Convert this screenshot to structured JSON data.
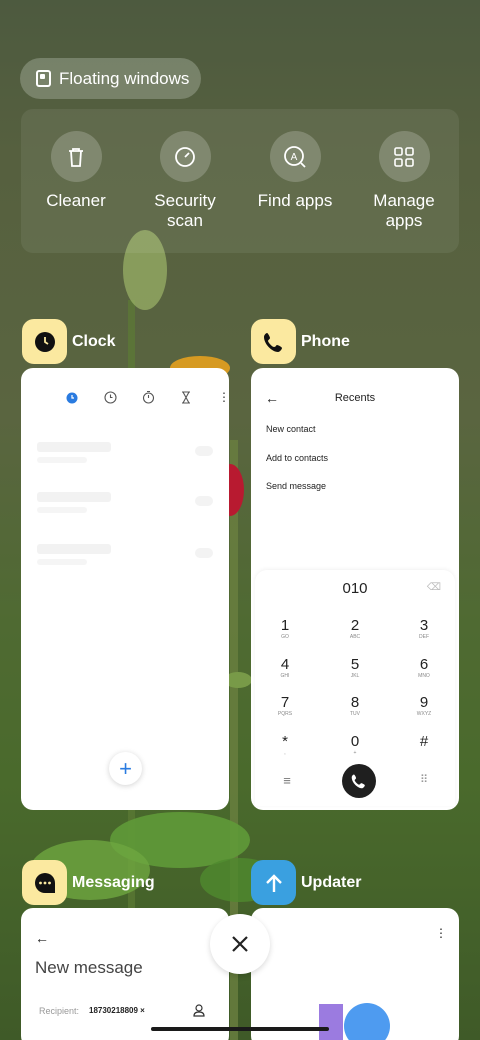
{
  "floating_windows": {
    "label": "Floating windows"
  },
  "tools": [
    {
      "label": "Cleaner",
      "icon": "trash-icon"
    },
    {
      "label": "Security\nscan",
      "icon": "security-scan-icon"
    },
    {
      "label": "Find apps",
      "icon": "find-apps-icon"
    },
    {
      "label": "Manage\napps",
      "icon": "grid-icon"
    }
  ],
  "apps": {
    "clock": {
      "name": "Clock",
      "icon_color": "#fbe9a0",
      "fab_label": "+"
    },
    "phone": {
      "name": "Phone",
      "icon_color": "#fbe9a0",
      "back": "←",
      "title": "Recents",
      "menu": [
        "New contact",
        "Add to contacts",
        "Send message"
      ],
      "dialed_number": "010",
      "delete_icon": "⌫",
      "keys": [
        {
          "digit": "1",
          "letters": "GO"
        },
        {
          "digit": "2",
          "letters": "ABC"
        },
        {
          "digit": "3",
          "letters": "DEF"
        },
        {
          "digit": "4",
          "letters": "GHI"
        },
        {
          "digit": "5",
          "letters": "JKL"
        },
        {
          "digit": "6",
          "letters": "MNO"
        },
        {
          "digit": "7",
          "letters": "PQRS"
        },
        {
          "digit": "8",
          "letters": "TUV"
        },
        {
          "digit": "9",
          "letters": "WXYZ"
        },
        {
          "digit": "*",
          "letters": ","
        },
        {
          "digit": "0",
          "letters": "+"
        },
        {
          "digit": "#",
          "letters": ""
        }
      ],
      "menu_glyph": "≡",
      "keypad_glyph": "⠿"
    },
    "messaging": {
      "name": "Messaging",
      "icon_color": "#fbe9a0",
      "back": "←",
      "title": "New message",
      "recipient_label": "Recipient:",
      "recipient_value": "18730218809 ×"
    },
    "updater": {
      "name": "Updater",
      "icon_color": "#3aa0e0",
      "menu": "⋮"
    }
  },
  "close_icon": "close-icon"
}
